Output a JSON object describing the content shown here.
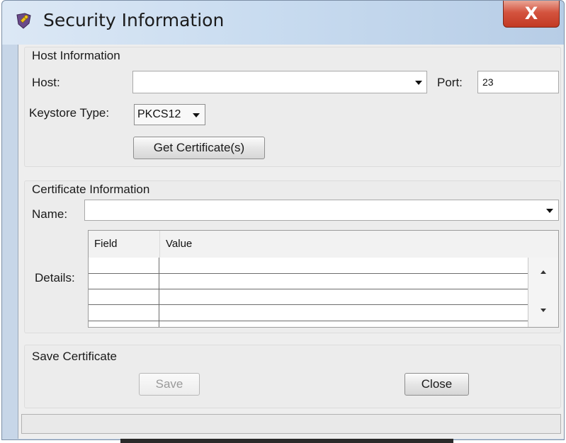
{
  "window": {
    "title": "Security Information",
    "close_label": "X",
    "icon": "shield-key-icon"
  },
  "host_section": {
    "title": "Host Information",
    "host_label": "Host:",
    "host_value": "",
    "port_label": "Port:",
    "port_value": "23",
    "keystore_label": "Keystore Type:",
    "keystore_value": "PKCS12",
    "get_cert_label": "Get Certificate(s)"
  },
  "cert_section": {
    "title": "Certificate Information",
    "name_label": "Name:",
    "name_value": "",
    "details_label": "Details:",
    "columns": [
      "Field",
      "Value"
    ],
    "rows": [
      [
        "",
        ""
      ],
      [
        "",
        ""
      ],
      [
        "",
        ""
      ],
      [
        "",
        ""
      ]
    ]
  },
  "save_section": {
    "title": "Save Certificate",
    "save_label": "Save",
    "close_label": "Close"
  },
  "status": {
    "text": ""
  }
}
